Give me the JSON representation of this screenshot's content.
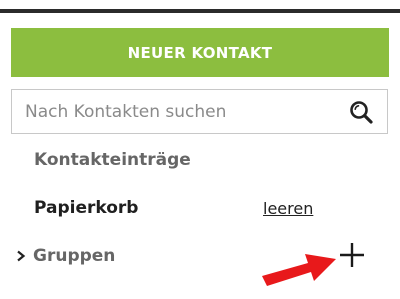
{
  "header": {
    "new_contact_label": "NEUER KONTAKT"
  },
  "search": {
    "placeholder": "Nach Kontakten suchen",
    "value": "",
    "icon": "search-icon"
  },
  "nav": {
    "contacts_label": "Kontakteinträge",
    "trash_label": "Papierkorb",
    "trash_action_label": "leeren",
    "groups_label": "Gruppen",
    "groups_expand_icon": "chevron-right-icon",
    "groups_add_icon": "plus-icon"
  },
  "annotation": {
    "arrow_icon": "red-arrow-icon",
    "arrow_color": "#e8191b"
  },
  "colors": {
    "accent": "#8cbe3f",
    "top_bar": "#2b2b2b",
    "muted_text": "#666666",
    "dark_text": "#1f1f1f"
  }
}
